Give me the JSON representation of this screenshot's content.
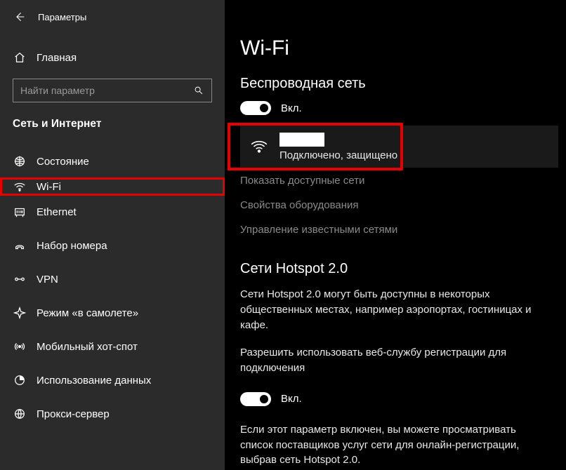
{
  "header": {
    "title": "Параметры"
  },
  "sidebar": {
    "home_label": "Главная",
    "search_placeholder": "Найти параметр",
    "section_title": "Сеть и Интернет",
    "items": [
      {
        "label": "Состояние",
        "icon": "status"
      },
      {
        "label": "Wi-Fi",
        "icon": "wifi",
        "highlighted": true
      },
      {
        "label": "Ethernet",
        "icon": "ethernet"
      },
      {
        "label": "Набор номера",
        "icon": "dialup"
      },
      {
        "label": "VPN",
        "icon": "vpn"
      },
      {
        "label": "Режим «в самолете»",
        "icon": "airplane"
      },
      {
        "label": "Мобильный хот-спот",
        "icon": "hotspot"
      },
      {
        "label": "Использование данных",
        "icon": "datausage"
      },
      {
        "label": "Прокси-сервер",
        "icon": "proxy"
      }
    ]
  },
  "main": {
    "title": "Wi-Fi",
    "wireless_header": "Беспроводная сеть",
    "toggle_wifi_label": "Вкл.",
    "network": {
      "ssid": "",
      "status": "Подключено, защищено"
    },
    "links": {
      "show_networks": "Показать доступные сети",
      "hardware_props": "Свойства оборудования",
      "manage_known": "Управление известными сетями"
    },
    "hotspot": {
      "header": "Сети Hotspot 2.0",
      "desc1": "Сети Hotspot 2.0 могут быть доступны в некоторых общественных местах, например аэропортах, гостиницах и кафе.",
      "desc2": "Разрешить использовать веб-службу регистрации для подключения",
      "toggle_label": "Вкл.",
      "desc3": "Если этот параметр включен, вы можете просматривать список поставщиков услуг сети для онлайн-регистрации, выбрав сеть Hotspot 2.0."
    }
  }
}
